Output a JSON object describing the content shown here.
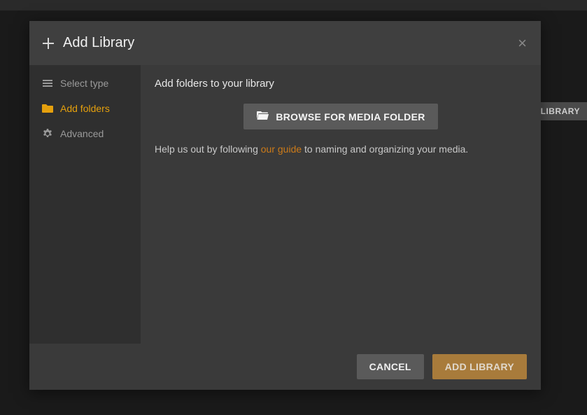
{
  "background": {
    "library_btn": "LIBRARY"
  },
  "modal": {
    "title": "Add Library",
    "close": "×"
  },
  "sidebar": {
    "items": [
      {
        "label": "Select type"
      },
      {
        "label": "Add folders"
      },
      {
        "label": "Advanced"
      }
    ]
  },
  "content": {
    "heading": "Add folders to your library",
    "browse_label": "BROWSE FOR MEDIA FOLDER",
    "help_before": "Help us out by following ",
    "help_link": "our guide",
    "help_after": " to naming and organizing your media."
  },
  "footer": {
    "cancel": "CANCEL",
    "add": "ADD LIBRARY"
  }
}
